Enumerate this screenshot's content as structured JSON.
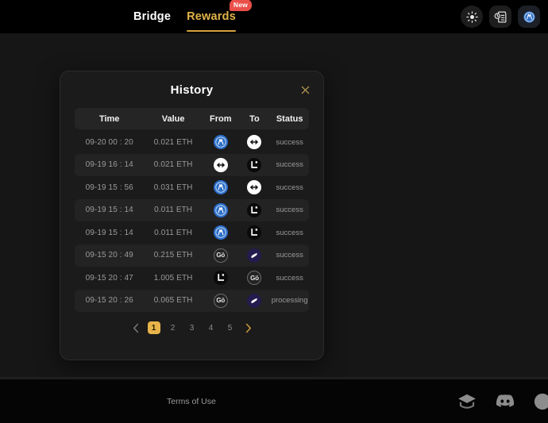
{
  "header": {
    "nav": [
      {
        "label": "Bridge",
        "active": false,
        "badge": null
      },
      {
        "label": "Rewards",
        "active": true,
        "badge": "New"
      }
    ],
    "actions": [
      {
        "name": "theme-toggle",
        "icon": "sun-icon"
      },
      {
        "name": "history-button",
        "icon": "document-clock-icon"
      },
      {
        "name": "wallet-button",
        "icon": "manta-token-icon"
      }
    ]
  },
  "modal": {
    "title": "History",
    "close_label": "×",
    "columns": [
      "Time",
      "Value",
      "From",
      "To",
      "Status"
    ],
    "rows": [
      {
        "time": "09-20 00 : 20",
        "value": "0.021 ETH",
        "from": "manta",
        "to": "taiko",
        "status": "success"
      },
      {
        "time": "09-19 16 : 14",
        "value": "0.021 ETH",
        "from": "taiko",
        "to": "linea",
        "status": "success"
      },
      {
        "time": "09-19 15 : 56",
        "value": "0.031 ETH",
        "from": "manta",
        "to": "taiko",
        "status": "success"
      },
      {
        "time": "09-19 15 : 14",
        "value": "0.011 ETH",
        "from": "manta",
        "to": "linea",
        "status": "success"
      },
      {
        "time": "09-19 15 : 14",
        "value": "0.011 ETH",
        "from": "manta",
        "to": "linea",
        "status": "success"
      },
      {
        "time": "09-15 20 : 49",
        "value": "0.215 ETH",
        "from": "goerli",
        "to": "scroll",
        "status": "success"
      },
      {
        "time": "09-15 20 : 47",
        "value": "1.005 ETH",
        "from": "linea",
        "to": "goerli",
        "status": "success"
      },
      {
        "time": "09-15 20 : 26",
        "value": "0.065 ETH",
        "from": "goerli",
        "to": "scroll",
        "status": "processing"
      }
    ],
    "pagination": {
      "prev": "‹",
      "next": "›",
      "pages": [
        "1",
        "2",
        "3",
        "4",
        "5"
      ],
      "current": "1"
    }
  },
  "chains": {
    "manta": {
      "label": "Manta",
      "color": "#2a6fd4"
    },
    "taiko": {
      "label": "Taiko",
      "color": "#ffffff"
    },
    "linea": {
      "label": "Linea",
      "color": "#0a0a0a"
    },
    "scroll": {
      "label": "Scroll",
      "color": "#231a4a"
    },
    "goerli": {
      "label": "Gö",
      "color": "#232323"
    }
  },
  "footer": {
    "terms": "Terms of Use",
    "socials": [
      {
        "name": "docs-book-icon"
      },
      {
        "name": "discord-icon"
      },
      {
        "name": "twitter-icon"
      }
    ]
  },
  "colors": {
    "accent": "#e2b44a",
    "badge": "#ea4f49",
    "page_bg": "#161616",
    "modal_bg": "#1b1b1b"
  }
}
